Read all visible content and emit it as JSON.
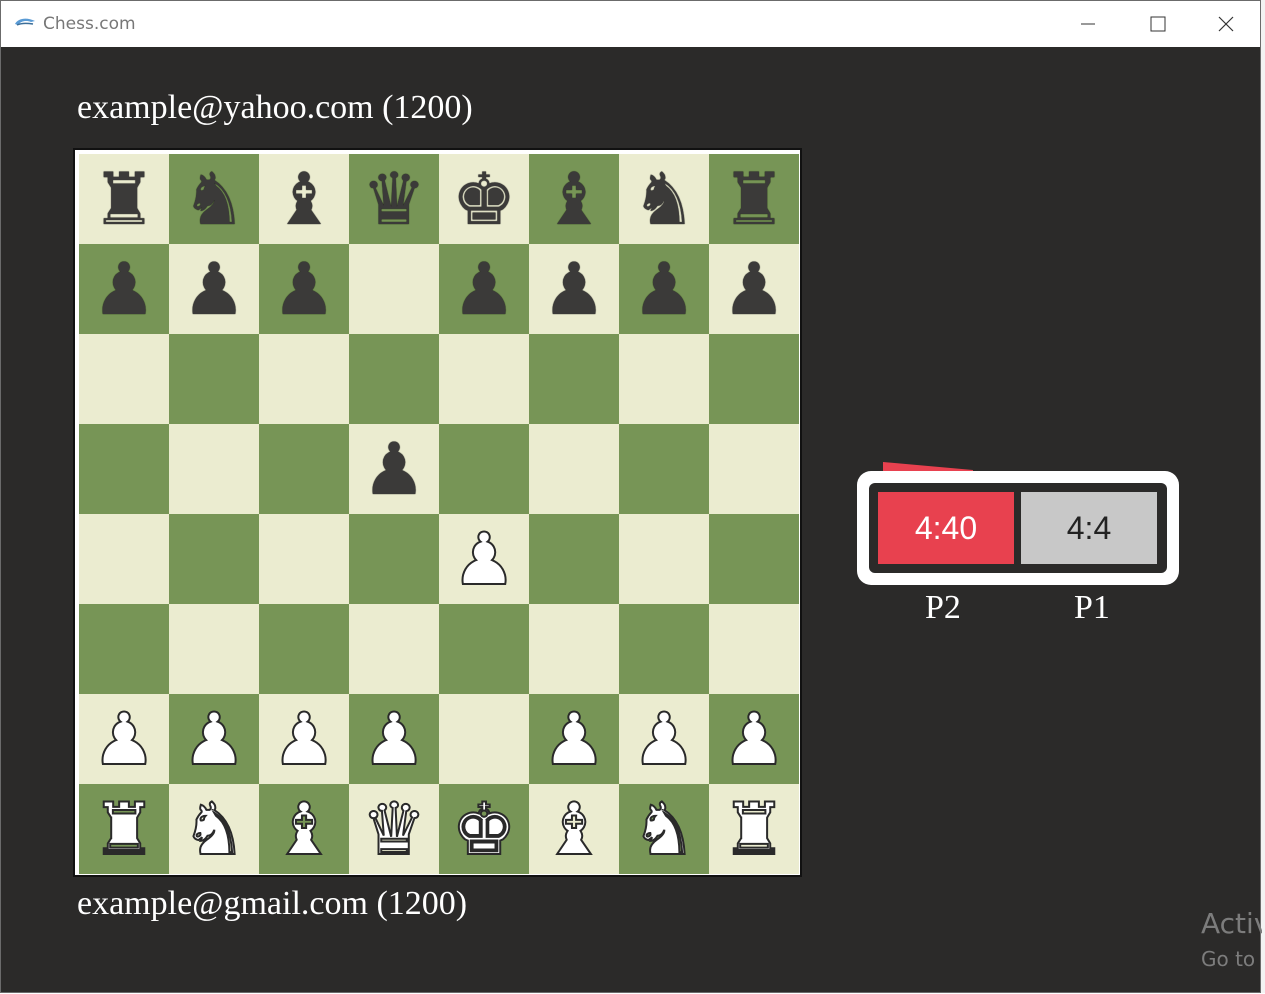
{
  "window": {
    "title": "Chess.com"
  },
  "players": {
    "top": "example@yahoo.com (1200)",
    "bottom": "example@gmail.com (1200)"
  },
  "clock": {
    "p2_time": "4:40",
    "p1_time": "4:4",
    "p2_label": "P2",
    "p1_label": "P1",
    "active_color": "#e8414f",
    "inactive_color": "#c8c8c8"
  },
  "board": {
    "light_color": "#ebecd0",
    "dark_color": "#779556",
    "ranks": [
      [
        "black-rook",
        "black-knight",
        "black-bishop",
        "black-queen",
        "black-king",
        "black-bishop",
        "black-knight",
        "black-rook"
      ],
      [
        "black-pawn",
        "black-pawn",
        "black-pawn",
        "",
        "black-pawn",
        "black-pawn",
        "black-pawn",
        "black-pawn"
      ],
      [
        "",
        "",
        "",
        "",
        "",
        "",
        "",
        ""
      ],
      [
        "",
        "",
        "",
        "black-pawn",
        "",
        "",
        "",
        ""
      ],
      [
        "",
        "",
        "",
        "",
        "white-pawn",
        "",
        "",
        ""
      ],
      [
        "",
        "",
        "",
        "",
        "",
        "",
        "",
        ""
      ],
      [
        "white-pawn",
        "white-pawn",
        "white-pawn",
        "white-pawn",
        "",
        "white-pawn",
        "white-pawn",
        "white-pawn"
      ],
      [
        "white-rook",
        "white-knight",
        "white-bishop",
        "white-queen",
        "white-king",
        "white-bishop",
        "white-knight",
        "white-rook"
      ]
    ]
  },
  "watermark": {
    "line1": "Activ",
    "line2": "Go to"
  }
}
